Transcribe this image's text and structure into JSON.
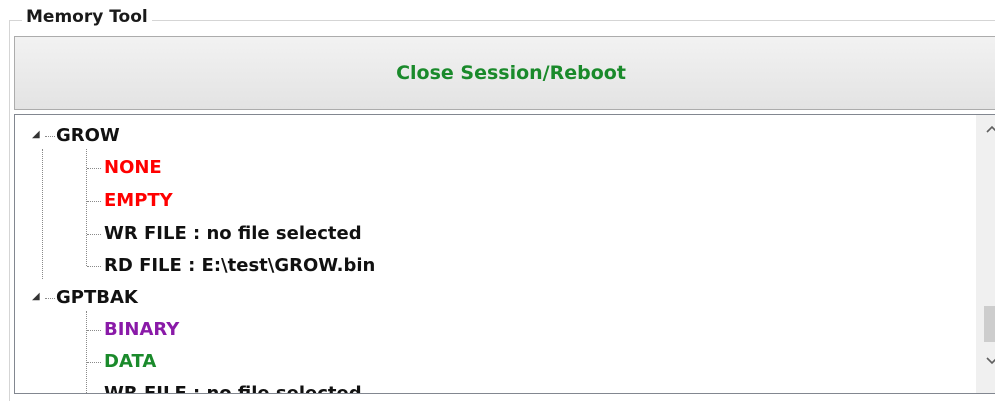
{
  "group": {
    "title": "Memory Tool"
  },
  "button": {
    "label": "Close Session/Reboot",
    "color": "#1a8a2b"
  },
  "tree": {
    "nodes": [
      {
        "label": "GROW",
        "expander": "◢",
        "children": [
          {
            "label": "NONE",
            "color": "#ff0000"
          },
          {
            "label": "EMPTY",
            "color": "#ff0000"
          },
          {
            "label": "WR FILE : no file selected",
            "color": "#111111"
          },
          {
            "label": "RD FILE : E:\\test\\GROW.bin",
            "color": "#111111"
          }
        ]
      },
      {
        "label": "GPTBAK",
        "expander": "◢",
        "children": [
          {
            "label": "BINARY",
            "color": "#8a1aa8"
          },
          {
            "label": "DATA",
            "color": "#1a8a2b"
          },
          {
            "label": "WR FILE : no file selected",
            "color": "#111111"
          }
        ]
      }
    ]
  },
  "scrollbar": {
    "up_icon": "chevron-up-icon",
    "down_icon": "chevron-down-icon"
  }
}
